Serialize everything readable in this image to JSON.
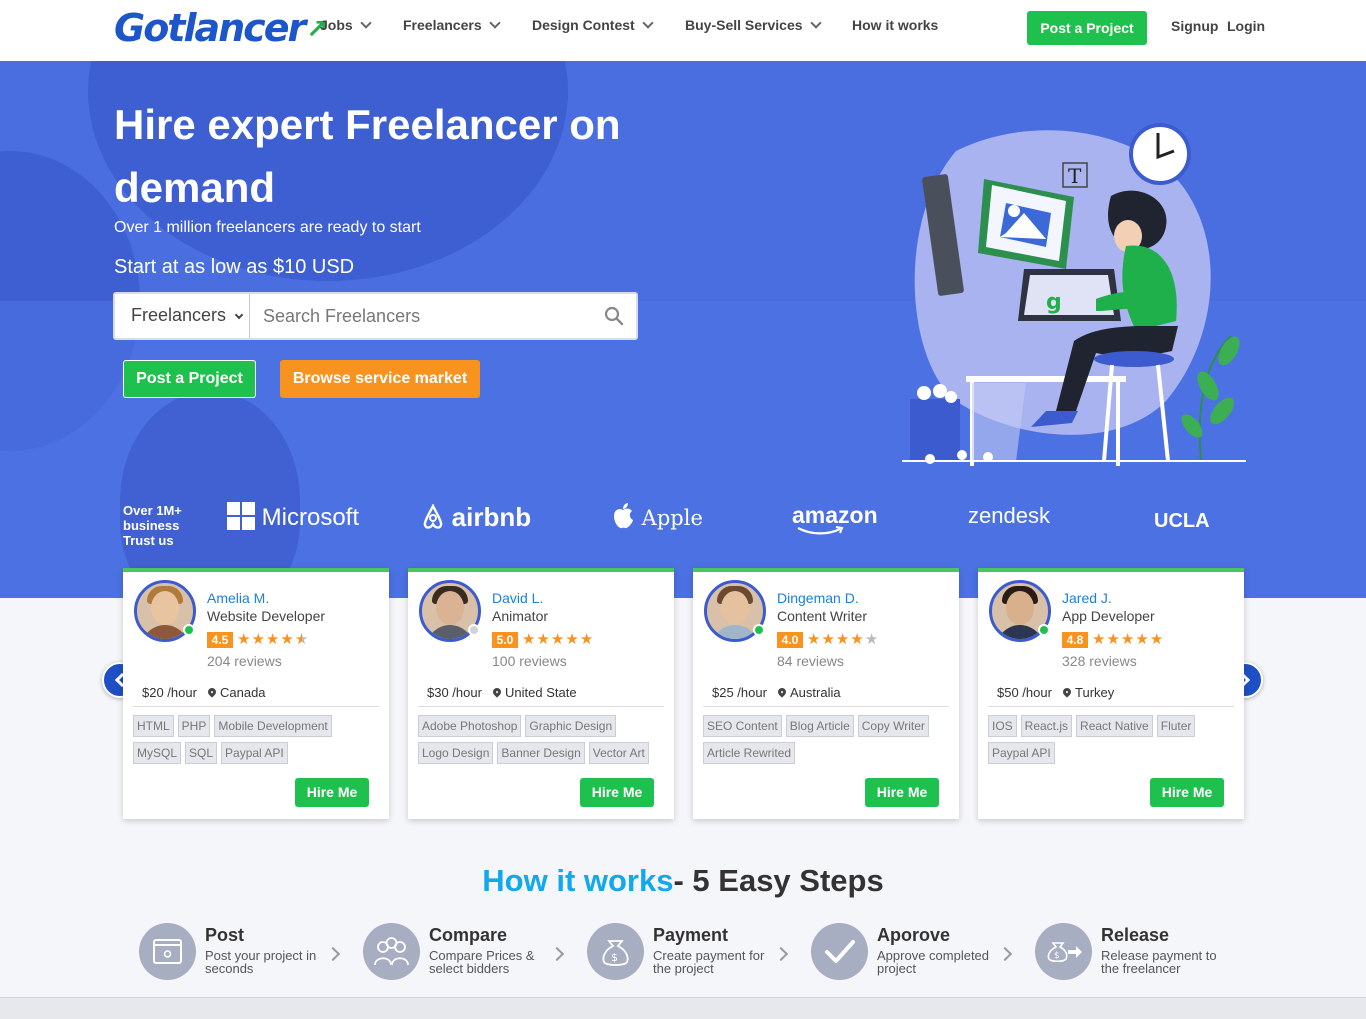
{
  "logo": {
    "text": "Gotlancer"
  },
  "nav": {
    "items": [
      {
        "label": "Jobs",
        "dropdown": true
      },
      {
        "label": "Freelancers",
        "dropdown": true
      },
      {
        "label": "Design Contest",
        "dropdown": true
      },
      {
        "label": "Buy-Sell Services",
        "dropdown": true
      },
      {
        "label": "How it works",
        "dropdown": false
      }
    ],
    "post_label": "Post a Project",
    "signup_label": "Signup",
    "login_label": "Login"
  },
  "hero": {
    "title": "Hire expert Freelancer on demand",
    "subtitle": "Over 1 million freelancers are ready to start",
    "price_line": "Start at as low as $10 USD",
    "search": {
      "category": "Freelancers",
      "placeholder": "Search Freelancers"
    },
    "post_button": "Post a Project",
    "browse_button": "Browse service market"
  },
  "trust": {
    "label_lines": [
      "Over 1M+",
      "business",
      "Trust us"
    ],
    "brands": [
      "Microsoft",
      "airbnb",
      "Apple",
      "amazon",
      "zendesk",
      "UCLA"
    ]
  },
  "freelancers": [
    {
      "name": "Amelia M.",
      "role": "Website Developer",
      "score": "4.5",
      "stars": 4.5,
      "reviews": "204 reviews",
      "rate": "$20 /hour",
      "location": "Canada",
      "online": true,
      "tags": [
        "HTML",
        "PHP",
        "Mobile Development",
        "MySQL",
        "SQL",
        "Paypal API"
      ],
      "hire": "Hire Me"
    },
    {
      "name": "David L.",
      "role": "Animator",
      "score": "5.0",
      "stars": 5,
      "reviews": "100 reviews",
      "rate": "$30 /hour",
      "location": "United State",
      "online": false,
      "tags": [
        "Adobe Photoshop",
        "Graphic Design",
        "Logo Design",
        "Banner Design",
        "Vector Art"
      ],
      "hire": "Hire Me"
    },
    {
      "name": "Dingeman D.",
      "role": "Content Writer",
      "score": "4.0",
      "stars": 4,
      "reviews": "84 reviews",
      "rate": "$25 /hour",
      "location": "Australia",
      "online": true,
      "tags": [
        "SEO Content",
        "Blog Article",
        "Copy Writer",
        "Article Rewrited"
      ],
      "hire": "Hire Me"
    },
    {
      "name": "Jared J.",
      "role": "App Developer",
      "score": "4.8",
      "stars": 5,
      "reviews": "328 reviews",
      "rate": "$50 /hour",
      "location": "Turkey",
      "online": true,
      "tags": [
        "IOS",
        "React.js",
        "React Native",
        "Fluter",
        "Paypal API"
      ],
      "hire": "Hire Me"
    }
  ],
  "how_it_works": {
    "title_highlight": "How it works",
    "title_rest": "- 5 Easy Steps",
    "steps": [
      {
        "title": "Post",
        "desc": "Post your project in seconds",
        "icon": "browser-icon"
      },
      {
        "title": "Compare",
        "desc": "Compare Prices & select bidders",
        "icon": "people-icon"
      },
      {
        "title": "Payment",
        "desc": "Create payment for the project",
        "icon": "money-bag-icon"
      },
      {
        "title": "Aporove",
        "desc": "Approve completed project",
        "icon": "checkmark-icon"
      },
      {
        "title": "Release",
        "desc": "Release payment to the freelancer",
        "icon": "release-money-icon"
      }
    ]
  },
  "colors": {
    "primary_blue": "#4a6ee0",
    "green": "#1fc14e",
    "orange": "#f7931e",
    "accent_blue": "#12a8ee"
  }
}
